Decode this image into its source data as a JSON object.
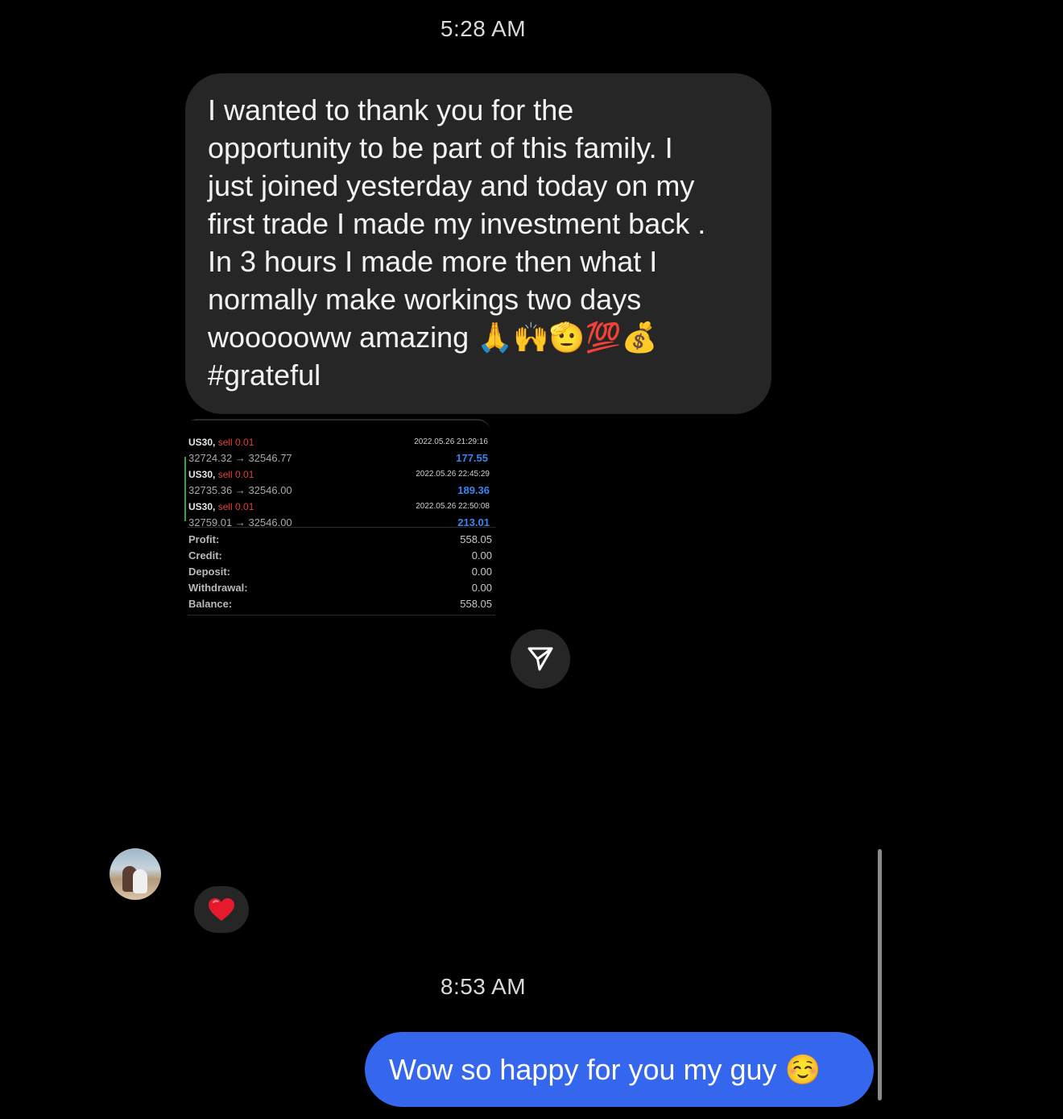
{
  "thread": {
    "timestamp_1": "5:28 AM",
    "timestamp_2": "8:53 AM"
  },
  "incoming_message": {
    "text": "I wanted to thank you for the\nopportunity to be part of this family. I\njust joined yesterday and today on my\nfirst trade I made my investment back .\nIn 3 hours I made more then what I\nnormally make workings two days\nwoooooww amazing 🙏🙌🫡💯💰\n#grateful"
  },
  "trade_screenshot": {
    "trades": [
      {
        "symbol": "US30,",
        "side": "sell 0.01",
        "prices": "32724.32 → 32546.77",
        "date": "2022.05.26 21:29:16",
        "profit": "177.55"
      },
      {
        "symbol": "US30,",
        "side": "sell 0.01",
        "prices": "32735.36 → 32546.00",
        "date": "2022.05.26 22:45:29",
        "profit": "189.36"
      },
      {
        "symbol": "US30,",
        "side": "sell 0.01",
        "prices": "32759.01 → 32546.00",
        "date": "2022.05.26 22:50:08",
        "profit": "213.01"
      }
    ],
    "summary": [
      {
        "label": "Profit:",
        "value": "558.05"
      },
      {
        "label": "Credit:",
        "value": "0.00"
      },
      {
        "label": "Deposit:",
        "value": "0.00"
      },
      {
        "label": "Withdrawal:",
        "value": "0.00"
      },
      {
        "label": "Balance:",
        "value": "558.05"
      }
    ]
  },
  "reaction": {
    "emoji": "❤️"
  },
  "outgoing_message": {
    "text": "Wow so happy for you my guy ☺️"
  },
  "icons": {
    "share": "send-icon",
    "avatar": "user-avatar"
  }
}
